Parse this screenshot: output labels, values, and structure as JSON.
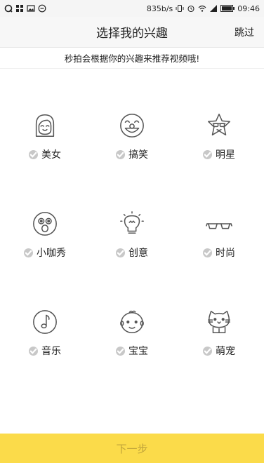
{
  "status_bar": {
    "net_speed": "835b/s",
    "time": "09:46"
  },
  "header": {
    "title": "选择我的兴趣",
    "skip_label": "跳过"
  },
  "subtitle": "秒拍会根据你的兴趣来推荐视频哦!",
  "interests": [
    {
      "label": "美女",
      "icon": "girl-face-icon"
    },
    {
      "label": "搞笑",
      "icon": "clown-face-icon"
    },
    {
      "label": "明星",
      "icon": "star-sunglasses-icon"
    },
    {
      "label": "小咖秀",
      "icon": "monkey-face-icon"
    },
    {
      "label": "创意",
      "icon": "lightbulb-icon"
    },
    {
      "label": "时尚",
      "icon": "glasses-icon"
    },
    {
      "label": "音乐",
      "icon": "music-disc-icon"
    },
    {
      "label": "宝宝",
      "icon": "baby-face-icon"
    },
    {
      "label": "萌宠",
      "icon": "cat-face-icon"
    }
  ],
  "next_button": "下一步",
  "colors": {
    "accent": "#fbdb4a",
    "check_unselected": "#c8c8c8"
  }
}
